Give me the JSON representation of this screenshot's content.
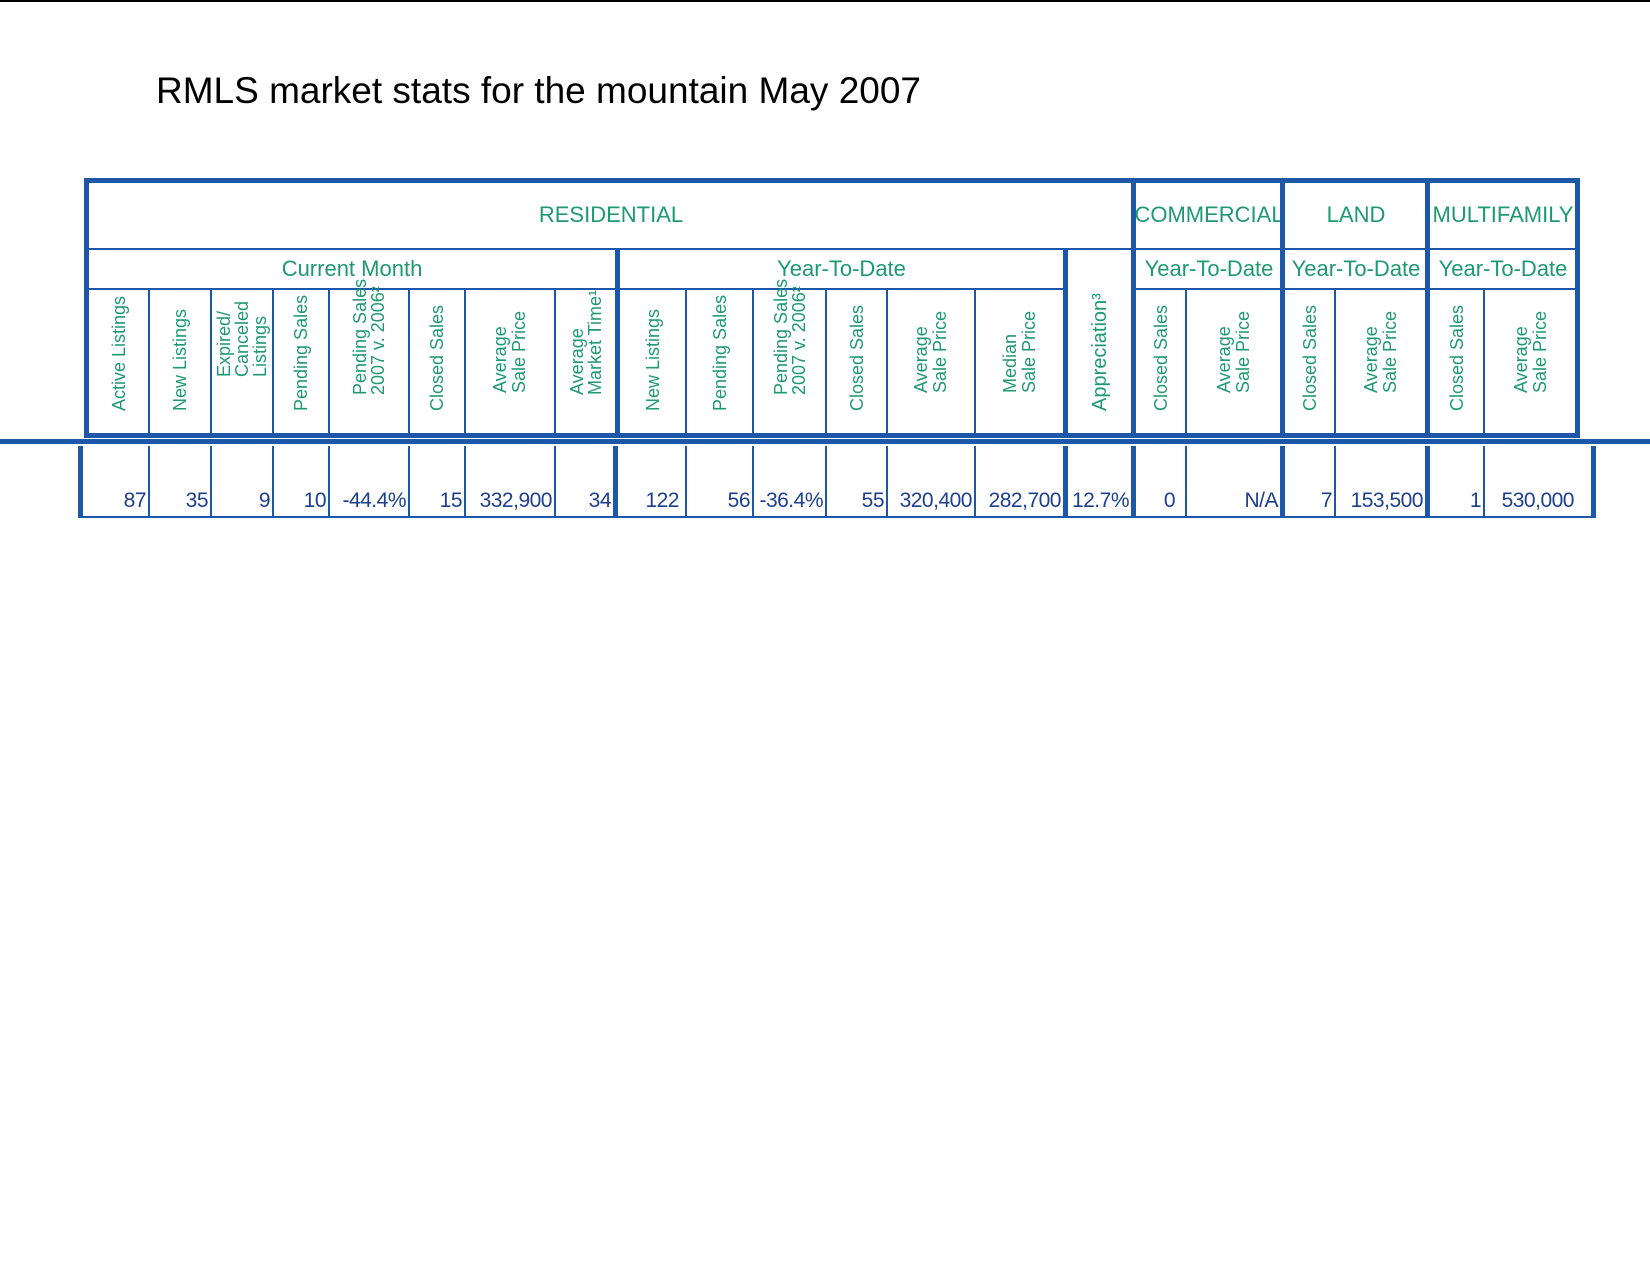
{
  "title": "RMLS market stats for the mountain May 2007",
  "colors": {
    "border": "#1c57a8",
    "header_text": "#1e9a6f",
    "value_text": "#1c3f8f"
  },
  "table": {
    "sections": {
      "residential": "RESIDENTIAL",
      "commercial": "COMMERCIAL",
      "land": "LAND",
      "multifamily": "MULTIFAMILY"
    },
    "subsections": {
      "current_month": "Current Month",
      "res_ytd": "Year-To-Date",
      "com_ytd": "Year-To-Date",
      "land_ytd": "Year-To-Date",
      "multi_ytd": "Year-To-Date"
    },
    "columns": [
      {
        "label": "Active Listings",
        "value": "87"
      },
      {
        "label": "New Listings",
        "value": "35"
      },
      {
        "label": "Expired/ Canceled Listings",
        "value": "9"
      },
      {
        "label": "Pending Sales",
        "value": "10"
      },
      {
        "label": "Pending Sales 2007 v. 2006²",
        "value": "-44.4%"
      },
      {
        "label": "Closed Sales",
        "value": "15"
      },
      {
        "label": "Average Sale Price",
        "value": "332,900"
      },
      {
        "label": "Average Market Time¹",
        "value": "34"
      },
      {
        "label": "New Listings",
        "value": "122"
      },
      {
        "label": "Pending Sales",
        "value": "56"
      },
      {
        "label": "Pending Sales 2007 v. 2006²",
        "value": "-36.4%"
      },
      {
        "label": "Closed Sales",
        "value": "55"
      },
      {
        "label": "Average Sale Price",
        "value": "320,400"
      },
      {
        "label": "Median Sale Price",
        "value": "282,700"
      },
      {
        "label": "Appreciation³",
        "value": "12.7%"
      },
      {
        "label": "Closed Sales",
        "value": "0"
      },
      {
        "label": "Average Sale Price",
        "value": "N/A"
      },
      {
        "label": "Closed Sales",
        "value": "7"
      },
      {
        "label": "Average Sale Price",
        "value": "153,500"
      },
      {
        "label": "Closed Sales",
        "value": "1"
      },
      {
        "label": "Average Sale Price",
        "value": "530,000"
      }
    ]
  }
}
